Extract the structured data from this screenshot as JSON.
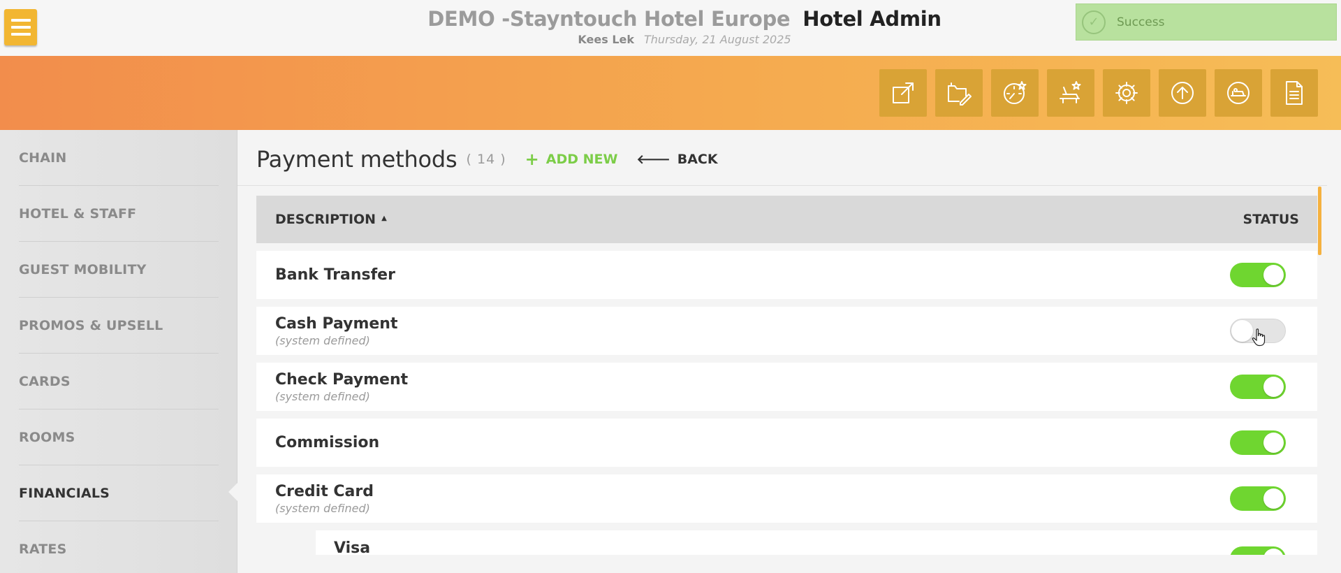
{
  "header": {
    "hotel_name": "DEMO -Stayntouch Hotel Europe",
    "app_name": "Hotel Admin",
    "user": "Kees Lek",
    "date": "Thursday, 21 August 2025"
  },
  "toast": {
    "message": "Success",
    "icon": "check-circle-icon"
  },
  "toolbar": {
    "icons": [
      "external-link-icon",
      "folder-edit-icon",
      "dashboard-star-icon",
      "housekeeping-star-icon",
      "settings-gear-icon",
      "upload-circle-icon",
      "guest-bed-icon",
      "document-icon"
    ]
  },
  "sidebar": {
    "items": [
      {
        "label": "CHAIN",
        "active": false
      },
      {
        "label": "HOTEL & STAFF",
        "active": false
      },
      {
        "label": "GUEST MOBILITY",
        "active": false
      },
      {
        "label": "PROMOS & UPSELL",
        "active": false
      },
      {
        "label": "CARDS",
        "active": false
      },
      {
        "label": "ROOMS",
        "active": false
      },
      {
        "label": "FINANCIALS",
        "active": true
      },
      {
        "label": "RATES",
        "active": false
      }
    ]
  },
  "main": {
    "title": "Payment methods",
    "count": "( 14 )",
    "add_new": "ADD NEW",
    "back": "BACK",
    "columns": {
      "description": "DESCRIPTION",
      "sort_indicator": "▲",
      "status": "STATUS"
    },
    "rows": [
      {
        "name": "Bank Transfer",
        "note": "",
        "enabled": true
      },
      {
        "name": "Cash Payment",
        "note": "(system defined)",
        "enabled": false
      },
      {
        "name": "Check Payment",
        "note": "(system defined)",
        "enabled": true
      },
      {
        "name": "Commission",
        "note": "",
        "enabled": true
      },
      {
        "name": "Credit Card",
        "note": "(system defined)",
        "enabled": true
      },
      {
        "name": "Visa",
        "note": "",
        "enabled": true,
        "sub": true
      }
    ]
  },
  "colors": {
    "accent_orange": "#f5aa4f",
    "toggle_on": "#6fd630",
    "success_bg": "#b8e19e",
    "add_new_green": "#7ccd48"
  }
}
